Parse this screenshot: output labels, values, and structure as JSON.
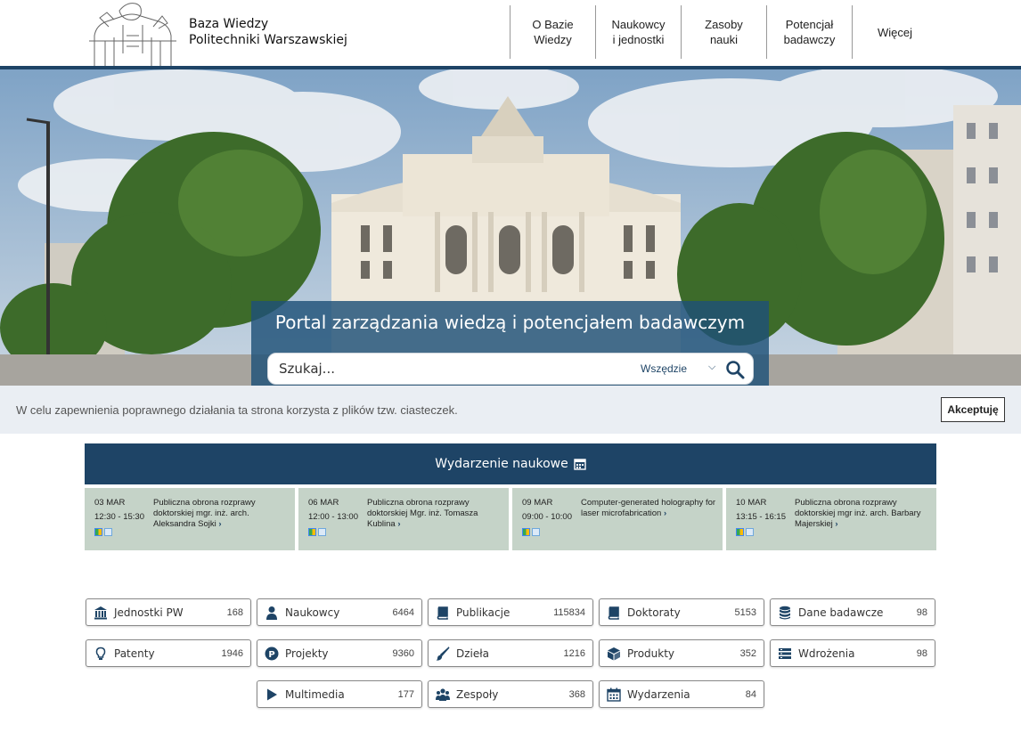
{
  "header": {
    "brand_line1": "Baza Wiedzy",
    "brand_line2": "Politechniki Warszawskiej",
    "nav": [
      {
        "label": "O Bazie\nWiedzy"
      },
      {
        "label": "Naukowcy\ni jednostki"
      },
      {
        "label": "Zasoby\nnauki"
      },
      {
        "label": "Potencjał\nbadawczy"
      },
      {
        "label": "Więcej"
      }
    ]
  },
  "hero": {
    "title": "Portal zarządzania wiedzą i potencjałem badawczym",
    "search_placeholder": "Szukaj...",
    "scope": "Wszędzie"
  },
  "cookie": {
    "text": "W celu zapewnienia poprawnego działania ta strona korzysta z plików tzw. ciasteczek.",
    "accept_label": "Akceptuję"
  },
  "events": {
    "header": "Wydarzenie naukowe",
    "items": [
      {
        "date": "03 MAR",
        "time": "12:30 - 15:30",
        "title": "Publiczna obrona rozprawy doktorskiej mgr. inż. arch. Aleksandra Sojki"
      },
      {
        "date": "06 MAR",
        "time": "12:00 - 13:00",
        "title": "Publiczna obrona rozprawy doktorskiej Mgr. inż. Tomasza Kublina"
      },
      {
        "date": "09 MAR",
        "time": "09:00 - 10:00",
        "title": "Computer-generated holography for laser microfabrication"
      },
      {
        "date": "10 MAR",
        "time": "13:15 - 16:15",
        "title": "Publiczna obrona rozprawy doktorskiej mgr inż. arch. Barbary Majerskiej"
      }
    ]
  },
  "categories": [
    {
      "label": "Jednostki PW",
      "count": "168",
      "icon": "institution-icon"
    },
    {
      "label": "Naukowcy",
      "count": "6464",
      "icon": "person-icon"
    },
    {
      "label": "Publikacje",
      "count": "115834",
      "icon": "book-icon"
    },
    {
      "label": "Doktoraty",
      "count": "5153",
      "icon": "book-icon"
    },
    {
      "label": "Dane badawcze",
      "count": "98",
      "icon": "database-icon"
    },
    {
      "label": "Patenty",
      "count": "1946",
      "icon": "lightbulb-icon"
    },
    {
      "label": "Projekty",
      "count": "9360",
      "icon": "project-icon"
    },
    {
      "label": "Dzieła",
      "count": "1216",
      "icon": "brush-icon"
    },
    {
      "label": "Produkty",
      "count": "352",
      "icon": "box-icon"
    },
    {
      "label": "Wdrożenia",
      "count": "98",
      "icon": "list-icon"
    },
    {
      "label": "Multimedia",
      "count": "177",
      "icon": "play-icon"
    },
    {
      "label": "Zespoły",
      "count": "368",
      "icon": "team-icon"
    },
    {
      "label": "Wydarzenia",
      "count": "84",
      "icon": "calendar-icon"
    }
  ],
  "colors": {
    "primary": "#1e4466",
    "event_bg": "#c5d3c8",
    "cookie_bg": "#eaeef3"
  }
}
